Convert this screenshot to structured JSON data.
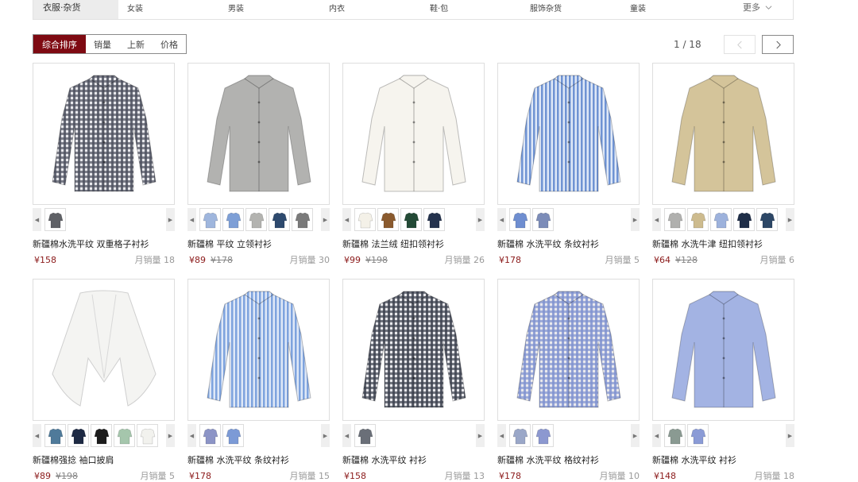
{
  "categories": {
    "active": "衣服·杂货",
    "items": [
      "女装",
      "男装",
      "内衣",
      "鞋·包",
      "服饰杂货",
      "童装"
    ],
    "more": "更多"
  },
  "sort": {
    "items": [
      "综合排序",
      "销量",
      "上新",
      "价格"
    ]
  },
  "pager": {
    "text": "1 / 18"
  },
  "products": [
    {
      "name": "新疆棉水洗平纹 双重格子衬衫",
      "price": "¥158",
      "old_price": "",
      "sales": "月销量 18",
      "swatches": [
        "#5f6166"
      ],
      "garment": {
        "type": "shirt",
        "color": "#4e5260",
        "pattern": "check"
      }
    },
    {
      "name": "新疆棉 平纹 立领衬衫",
      "price": "¥89",
      "old_price": "¥178",
      "sales": "月销量 30",
      "swatches": [
        "#9fb6dd",
        "#7e9fd6",
        "#b3b3b0",
        "#2e4a6e",
        "#7a7a7a"
      ],
      "garment": {
        "type": "shirt",
        "color": "#b2b2b0",
        "pattern": "plain"
      }
    },
    {
      "name": "新疆棉 法兰绒 纽扣领衬衫",
      "price": "¥99",
      "old_price": "¥198",
      "sales": "月销量 26",
      "swatches": [
        "#f4f1e8",
        "#8a5a2e",
        "#234a36",
        "#25334e"
      ],
      "garment": {
        "type": "shirt",
        "color": "#f6f4ee",
        "pattern": "plain"
      }
    },
    {
      "name": "新疆棉 水洗平纹 条纹衬衫",
      "price": "¥178",
      "old_price": "",
      "sales": "月销量 5",
      "swatches": [
        "#6f8ed0",
        "#7c8cb8"
      ],
      "garment": {
        "type": "shirt",
        "color": "#6f93d3",
        "pattern": "stripe"
      }
    },
    {
      "name": "新疆棉 水洗牛津 纽扣领衬衫",
      "price": "¥64",
      "old_price": "¥128",
      "sales": "月销量 6",
      "swatches": [
        "#b0b0ae",
        "#cdbb8e",
        "#9db2dc",
        "#1f2e48",
        "#2d4766"
      ],
      "garment": {
        "type": "shirt",
        "color": "#d4c49a",
        "pattern": "plain"
      }
    },
    {
      "name": "新疆棉强捻 袖口披肩",
      "price": "¥89",
      "old_price": "¥198",
      "sales": "月销量 5",
      "swatches": [
        "#4f7a9a",
        "#1e2a44",
        "#1c1c1c",
        "#a5c6ac",
        "#f2f2ee"
      ],
      "garment": {
        "type": "cape",
        "color": "#f4f4f2",
        "pattern": "plain"
      }
    },
    {
      "name": "新疆棉 水洗平纹 条纹衬衫",
      "price": "¥178",
      "old_price": "",
      "sales": "月销量 15",
      "swatches": [
        "#8c94c6",
        "#7c9ad6"
      ],
      "garment": {
        "type": "shirt",
        "color": "#7ea3de",
        "pattern": "stripe"
      }
    },
    {
      "name": "新疆棉 水洗平纹 衬衫",
      "price": "¥158",
      "old_price": "",
      "sales": "月销量 13",
      "swatches": [
        "#6a6f78"
      ],
      "garment": {
        "type": "shirt",
        "color": "#3e4350",
        "pattern": "check"
      }
    },
    {
      "name": "新疆棉 水洗平纹 格纹衬衫",
      "price": "¥178",
      "old_price": "",
      "sales": "月销量 10",
      "swatches": [
        "#9aa7c8",
        "#8c98d0"
      ],
      "garment": {
        "type": "shirt",
        "color": "#8193d1",
        "pattern": "check"
      }
    },
    {
      "name": "新疆棉 水洗平纹 衬衫",
      "price": "¥148",
      "old_price": "",
      "sales": "月销量 18",
      "swatches": [
        "#8a9a92",
        "#8b9bd6"
      ],
      "garment": {
        "type": "shirt",
        "color": "#a3b3e3",
        "pattern": "plain"
      }
    }
  ]
}
